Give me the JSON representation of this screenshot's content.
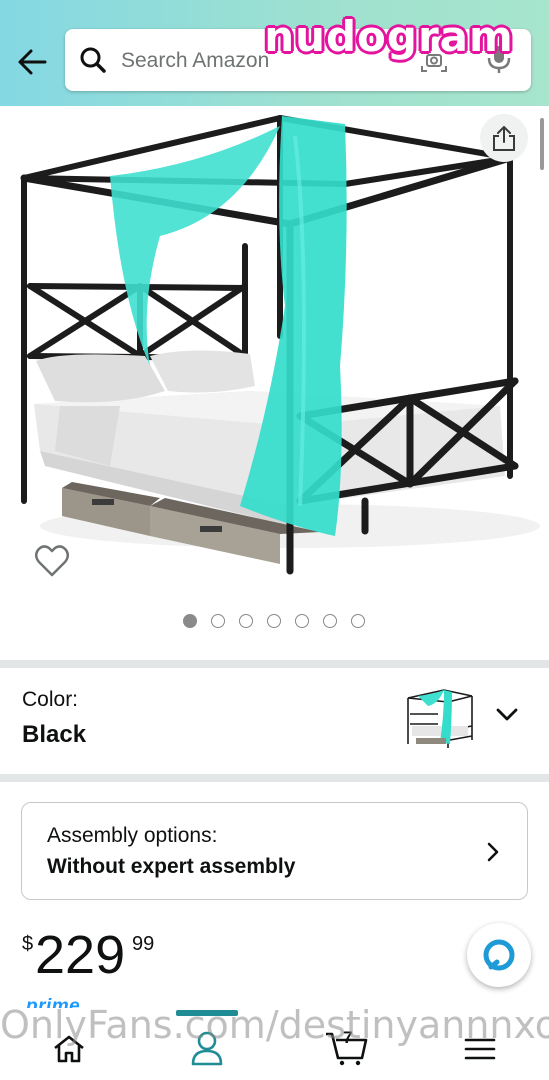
{
  "header": {
    "search_placeholder": "Search Amazon",
    "icons": [
      "back-arrow-icon",
      "search-icon",
      "camera-icon",
      "mic-icon"
    ],
    "gradient_colors": [
      "#84d8e3",
      "#a7e5cd"
    ]
  },
  "overlay": {
    "top_watermark": "nudogram",
    "bottom_watermark": "OnlyFans.com/destinyannnxox"
  },
  "gallery": {
    "image_count": 7,
    "active_index": 0,
    "curtain_color": "#3fe0d0",
    "frame_color": "#1c1c1c"
  },
  "color_selector": {
    "label": "Color:",
    "value": "Black"
  },
  "assembly": {
    "title": "Assembly options:",
    "value": "Without expert assembly"
  },
  "price": {
    "symbol": "$",
    "whole": "229",
    "fraction": "99"
  },
  "prime": {
    "label": "prime"
  },
  "bottom_nav": {
    "items": [
      "home",
      "account",
      "cart",
      "menu"
    ],
    "active": "account",
    "cart_count": "7",
    "accent_color": "#1f8c96"
  }
}
